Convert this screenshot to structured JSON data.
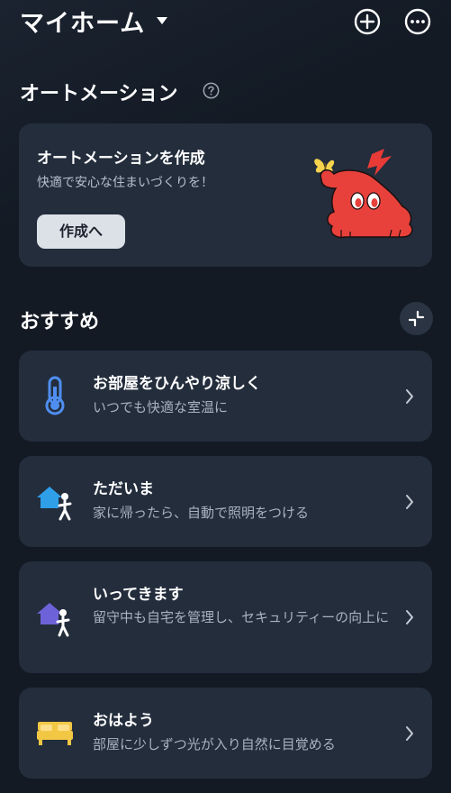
{
  "header": {
    "home_title": "マイホーム",
    "dropdown_icon": "caret-down-icon",
    "add_icon": "plus-circle-icon",
    "more_icon": "more-horizontal-icon"
  },
  "automation": {
    "section_title": "オートメーション",
    "help_icon": "question-circle-icon",
    "create_card": {
      "title": "オートメーションを作成",
      "subtitle": "快適で安心な住まいづくりを！",
      "button_label": "作成へ",
      "mascot_icon": "red-creature-mascot"
    }
  },
  "recommended": {
    "section_title": "おすすめ",
    "action_icon": "collapse-arrows-icon",
    "items": [
      {
        "title": "お部屋をひんやり涼しく",
        "subtitle": "いつでも快適な室温に",
        "icon": "thermometer-icon"
      },
      {
        "title": "ただいま",
        "subtitle": "家に帰ったら、自動で照明をつける",
        "icon": "home-arrive-icon"
      },
      {
        "title": "いってきます",
        "subtitle": "留守中も自宅を管理し、セキュリティーの向上に",
        "icon": "home-leave-icon"
      },
      {
        "title": "おはよう",
        "subtitle": "部屋に少しずつ光が入り自然に目覚める",
        "icon": "bed-icon"
      }
    ]
  },
  "colors": {
    "background": "#131a24",
    "card": "#232d3c",
    "mascot_red": "#e8413b",
    "bolt_red": "#e83a36",
    "butterfly_yellow": "#f6d34d",
    "thermo_blue": "#4f8ef0",
    "arrive_blue": "#2f9fe8",
    "leave_purple": "#6e62d8",
    "bed_yellow": "#f2c744"
  }
}
